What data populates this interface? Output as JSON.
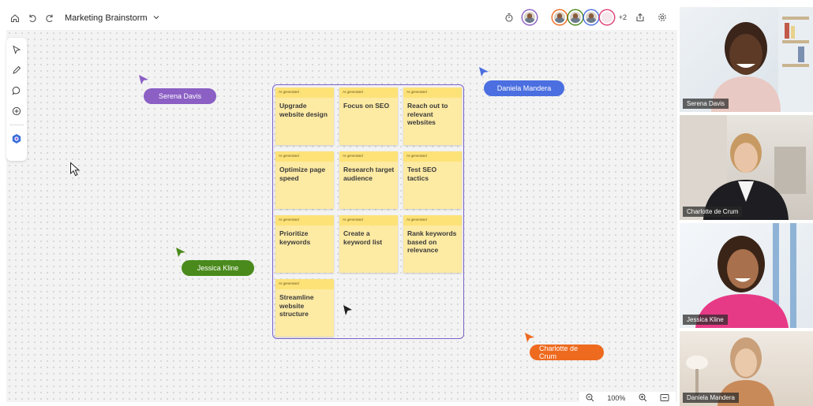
{
  "topbar": {
    "title": "Marketing Brainstorm",
    "extra_participants": "+2"
  },
  "cursors": {
    "serena": {
      "name": "Serena Davis",
      "color": "#8b5fc4"
    },
    "daniela": {
      "name": "Daniela Mandera",
      "color": "#4b6fe0"
    },
    "jessica": {
      "name": "Jessica Kline",
      "color": "#4a8a1c"
    },
    "charlotte": {
      "name": "Charlotte de Crum",
      "color": "#ee6a1f"
    }
  },
  "notes": [
    {
      "tag": "AI generated",
      "text": "Upgrade website design"
    },
    {
      "tag": "AI generated",
      "text": "Focus on SEO"
    },
    {
      "tag": "AI generated",
      "text": "Reach out to relevant websites"
    },
    {
      "tag": "AI generated",
      "text": "Optimize page speed"
    },
    {
      "tag": "AI generated",
      "text": "Research target audience"
    },
    {
      "tag": "AI generated",
      "text": "Test SEO tactics"
    },
    {
      "tag": "AI generated",
      "text": "Prioritize keywords"
    },
    {
      "tag": "AI generated",
      "text": "Create a keyword list"
    },
    {
      "tag": "AI generated",
      "text": "Rank keywords based on relevance"
    },
    {
      "tag": "AI generated",
      "text": "Streamline website structure"
    }
  ],
  "videos": [
    {
      "name": "Serena Davis"
    },
    {
      "name": "Charlotte de Crum"
    },
    {
      "name": "Jessica Kline"
    },
    {
      "name": "Daniela Mandera"
    }
  ],
  "zoom": {
    "level": "100%"
  }
}
